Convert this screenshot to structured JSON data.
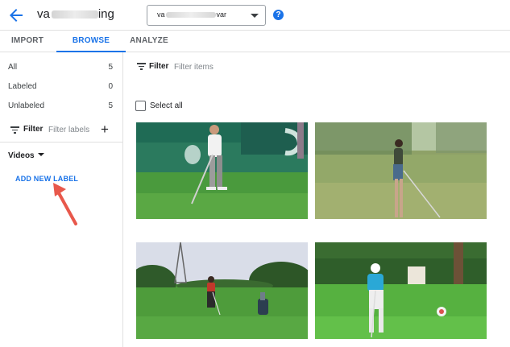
{
  "header": {
    "dataset_name_visible": "va",
    "dataset_name_tail": "ing",
    "select": {
      "value_head": "va",
      "value_tail": "var"
    },
    "help_glyph": "?",
    "icons": {
      "back": "arrow-back-icon",
      "help": "help-icon",
      "dropdown": "arrow-drop-down-icon"
    }
  },
  "tabs": [
    {
      "label": "IMPORT",
      "active": false
    },
    {
      "label": "BROWSE",
      "active": true
    },
    {
      "label": "ANALYZE",
      "active": false
    }
  ],
  "sidebar": {
    "counts": [
      {
        "label": "All",
        "value": "5"
      },
      {
        "label": "Labeled",
        "value": "0"
      },
      {
        "label": "Unlabeled",
        "value": "5"
      }
    ],
    "filter": {
      "label": "Filter",
      "placeholder": "Filter labels",
      "add_glyph": "+"
    },
    "section": {
      "label": "Videos"
    },
    "add_label": "ADD NEW LABEL"
  },
  "main": {
    "filter": {
      "label": "Filter",
      "placeholder": "Filter items"
    },
    "select_all": "Select all",
    "thumbnails": [
      {
        "subject": "golfer-tournament"
      },
      {
        "subject": "golfer-driving-range"
      },
      {
        "subject": "golfer-fairway"
      },
      {
        "subject": "golfer-tee-box"
      }
    ]
  },
  "colors": {
    "accent": "#1a73e8",
    "annotation_arrow": "#e8584b",
    "divider": "#e0e0e0"
  }
}
